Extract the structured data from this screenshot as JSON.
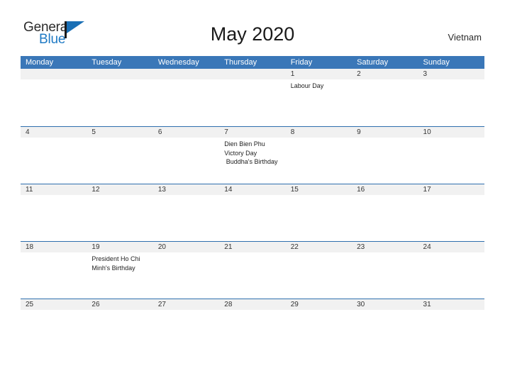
{
  "brand": {
    "name_part1": "General",
    "name_part2": "Blue",
    "flag_icon": "blue-triangle-flag-icon"
  },
  "header": {
    "title": "May 2020",
    "country": "Vietnam"
  },
  "calendar": {
    "weekday_headers": [
      "Monday",
      "Tuesday",
      "Wednesday",
      "Thursday",
      "Friday",
      "Saturday",
      "Sunday"
    ],
    "colors": {
      "header_blue": "#3a77b8",
      "row_divider_blue": "#2f6fae",
      "date_band_gray": "#f1f1f1",
      "brand_blue": "#1f7ac4",
      "text": "#222222"
    },
    "weeks": [
      {
        "days": [
          {
            "date": "",
            "events": []
          },
          {
            "date": "",
            "events": []
          },
          {
            "date": "",
            "events": []
          },
          {
            "date": "",
            "events": []
          },
          {
            "date": "1",
            "events": [
              "Labour Day"
            ]
          },
          {
            "date": "2",
            "events": []
          },
          {
            "date": "3",
            "events": []
          }
        ]
      },
      {
        "days": [
          {
            "date": "4",
            "events": []
          },
          {
            "date": "5",
            "events": []
          },
          {
            "date": "6",
            "events": []
          },
          {
            "date": "7",
            "events": [
              "Dien Bien Phu Victory Day",
              " Buddha's Birthday"
            ]
          },
          {
            "date": "8",
            "events": []
          },
          {
            "date": "9",
            "events": []
          },
          {
            "date": "10",
            "events": []
          }
        ]
      },
      {
        "days": [
          {
            "date": "11",
            "events": []
          },
          {
            "date": "12",
            "events": []
          },
          {
            "date": "13",
            "events": []
          },
          {
            "date": "14",
            "events": []
          },
          {
            "date": "15",
            "events": []
          },
          {
            "date": "16",
            "events": []
          },
          {
            "date": "17",
            "events": []
          }
        ]
      },
      {
        "days": [
          {
            "date": "18",
            "events": []
          },
          {
            "date": "19",
            "events": [
              "President Ho Chi Minh's Birthday"
            ]
          },
          {
            "date": "20",
            "events": []
          },
          {
            "date": "21",
            "events": []
          },
          {
            "date": "22",
            "events": []
          },
          {
            "date": "23",
            "events": []
          },
          {
            "date": "24",
            "events": []
          }
        ]
      },
      {
        "days": [
          {
            "date": "25",
            "events": []
          },
          {
            "date": "26",
            "events": []
          },
          {
            "date": "27",
            "events": []
          },
          {
            "date": "28",
            "events": []
          },
          {
            "date": "29",
            "events": []
          },
          {
            "date": "30",
            "events": []
          },
          {
            "date": "31",
            "events": []
          }
        ]
      }
    ]
  }
}
